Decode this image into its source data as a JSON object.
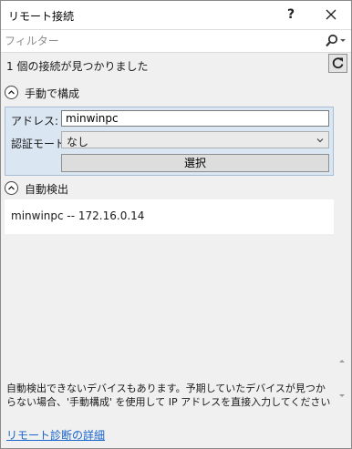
{
  "window": {
    "title": "リモート接続",
    "help_label": "?"
  },
  "filter": {
    "placeholder": "フィルター"
  },
  "status": {
    "found_text": "1 個の接続が見つかりました"
  },
  "manual": {
    "header": "手動で構成",
    "address_label": "アドレス:",
    "address_value": "minwinpc",
    "auth_label": "認証モード:",
    "auth_value": "なし",
    "select_button": "選択"
  },
  "auto": {
    "header": "自動検出",
    "devices": [
      "minwinpc -- 172.16.0.14"
    ]
  },
  "footer": {
    "note": "自動検出できないデバイスもあります。予期していたデバイスが見つからない場合、'手動構成' を使用して IP アドレスを直接入力してください",
    "link": "リモート診断の詳細"
  },
  "icons": {
    "close": "close-icon",
    "search": "search-icon",
    "refresh": "refresh-icon",
    "collapse": "chevron-up-circle-icon",
    "dropdown": "chevron-down-icon"
  },
  "colors": {
    "link": "#1a66cc",
    "panel": "#dbe6f3"
  }
}
